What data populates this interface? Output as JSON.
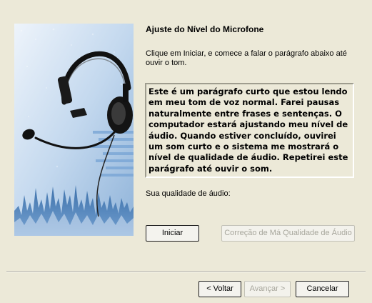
{
  "wizard": {
    "title": "Ajuste do Nível do Microfone",
    "instructions": "Clique em Iniciar, e comece a falar o parágrafo abaixo até ouvir o tom.",
    "passage": "Este é um parágrafo curto que estou lendo em meu tom de voz normal. Farei pausas naturalmente entre frases e sentenças. O computador estará ajustando meu nível de áudio. Quando estiver concluído, ouvirei um som curto e o sistema me mostrará o nível de qualidade de áudio. Repetirei este parágrafo até ouvir o som.",
    "quality_label": "Sua qualidade de áudio:",
    "start_label": "Iniciar",
    "poor_quality_label": "Correção de Má Qualidade de Áudio"
  },
  "footer": {
    "back_label": "< Voltar",
    "next_label": "Avançar >",
    "cancel_label": "Cancelar"
  },
  "illustration": {
    "icon": "headset-microphone-icon"
  },
  "colors": {
    "window_bg": "#ECE9D8",
    "illustration_blue": "#3a6fa8",
    "disabled_text": "#A7A69C"
  }
}
